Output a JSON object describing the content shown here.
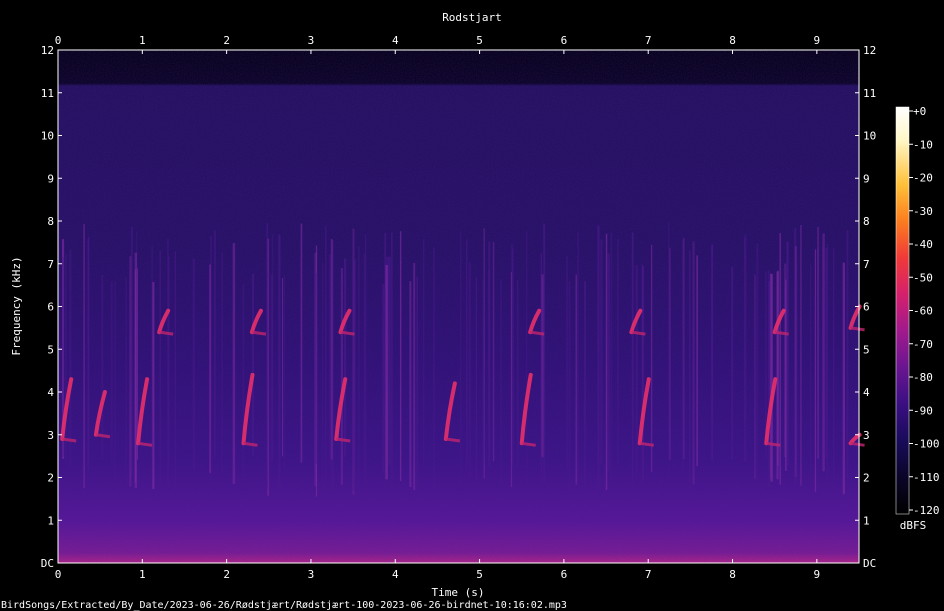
{
  "chart_data": {
    "type": "heatmap",
    "title": "Rodstjart",
    "xlabel": "Time (s)",
    "ylabel": "Frequency (kHz)",
    "x_ticks": [
      "0",
      "1",
      "2",
      "3",
      "4",
      "5",
      "6",
      "7",
      "8",
      "9"
    ],
    "y_ticks": [
      "DC",
      "1",
      "2",
      "3",
      "4",
      "5",
      "6",
      "7",
      "8",
      "9",
      "10",
      "11",
      "12"
    ],
    "xlim": [
      0,
      9.5
    ],
    "ylim": [
      0,
      12
    ],
    "colorbar": {
      "label": "dBFS",
      "ticks": [
        "+0",
        "-10",
        "-20",
        "-30",
        "-40",
        "-50",
        "-60",
        "-70",
        "-80",
        "-90",
        "-100",
        "-110",
        "-120"
      ],
      "range": [
        -120,
        0
      ]
    },
    "song_phrases": [
      {
        "t": 0.05,
        "f_low": 2.9,
        "f_high": 4.3
      },
      {
        "t": 0.45,
        "f_low": 3.0,
        "f_high": 4.0
      },
      {
        "t": 0.95,
        "f_low": 2.8,
        "f_high": 4.3
      },
      {
        "t": 1.2,
        "f_low": 5.4,
        "f_high": 5.9
      },
      {
        "t": 2.2,
        "f_low": 2.8,
        "f_high": 4.4
      },
      {
        "t": 2.3,
        "f_low": 5.4,
        "f_high": 5.9
      },
      {
        "t": 3.3,
        "f_low": 2.9,
        "f_high": 4.3
      },
      {
        "t": 3.35,
        "f_low": 5.4,
        "f_high": 5.9
      },
      {
        "t": 4.6,
        "f_low": 2.9,
        "f_high": 4.2
      },
      {
        "t": 5.5,
        "f_low": 2.8,
        "f_high": 4.4
      },
      {
        "t": 5.6,
        "f_low": 5.4,
        "f_high": 5.9
      },
      {
        "t": 6.9,
        "f_low": 2.8,
        "f_high": 4.3
      },
      {
        "t": 6.8,
        "f_low": 5.4,
        "f_high": 5.9
      },
      {
        "t": 8.4,
        "f_low": 2.8,
        "f_high": 4.3
      },
      {
        "t": 8.5,
        "f_low": 5.4,
        "f_high": 5.9
      },
      {
        "t": 9.4,
        "f_low": 2.8,
        "f_high": 3.0
      },
      {
        "t": 9.4,
        "f_low": 5.5,
        "f_high": 6.0
      }
    ]
  },
  "source_path": "BirdSongs/Extracted/By_Date/2023-06-26/Rødstjært/Rødstjært-100-2023-06-26-birdnet-10:16:02.mp3",
  "colors": {
    "background": "#000000",
    "colormap": [
      "#000000",
      "#0a0528",
      "#190b5a",
      "#3a0f82",
      "#6a1591",
      "#a01a8c",
      "#d4206c",
      "#f03a38",
      "#fb7d1e",
      "#ffc13a",
      "#fff7c8",
      "#ffffff"
    ]
  }
}
